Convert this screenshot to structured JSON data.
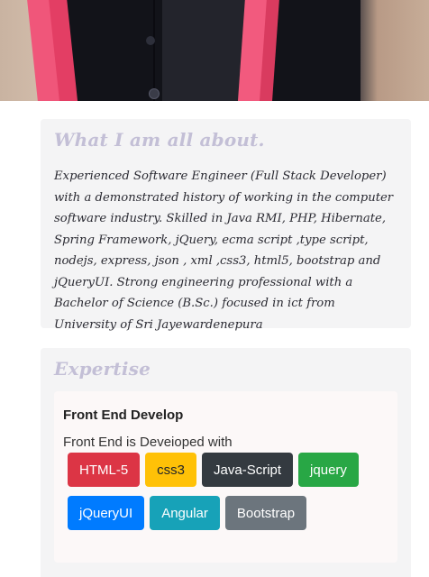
{
  "about": {
    "title": "What I am all about.",
    "text": "Experienced Software Engineer (Full Stack Developer) with a demonstrated history of working in the computer software industry. Skilled in Java RMI, PHP, Hibernate, Spring Framework, jQuery, ecma script ,type script, nodejs, express, json , xml ,css3, html5, bootstrap and jQueryUI. Strong engineering professional with a Bachelor of Science (B.Sc.) focused in ict from University of Sri Jayewardenepura"
  },
  "expertise": {
    "title": "Expertise",
    "card_title": "Front End Develop",
    "card_subtitle": "Front End is Deveioped with",
    "badges": [
      "HTML-5",
      "css3",
      "Java-Script",
      "jquery",
      "jQueryUI",
      "Angular",
      "Bootstrap"
    ]
  },
  "colors": {
    "badge_red": "#dc3545",
    "badge_yellow": "#ffc107",
    "badge_dark": "#343a40",
    "badge_green": "#28a745",
    "badge_blue": "#007bff",
    "badge_cyan": "#17a2b8",
    "badge_gray": "#6c757d",
    "section_title": "#c3bfd6"
  }
}
